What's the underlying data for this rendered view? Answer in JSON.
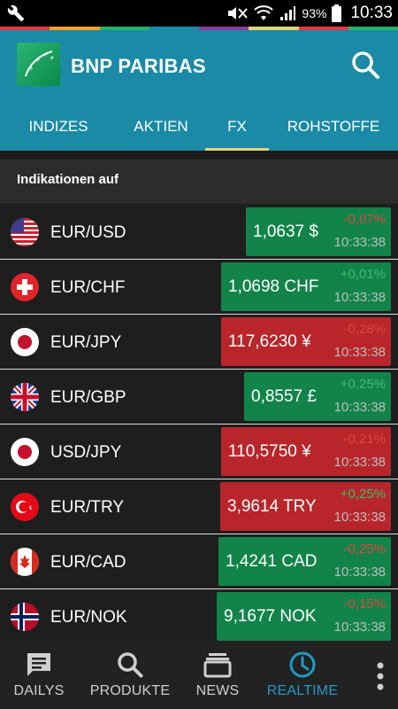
{
  "status_bar": {
    "battery_percent": "93%",
    "time": "10:33",
    "icons": [
      "wrench-icon",
      "mute-icon",
      "wifi-icon",
      "signal-icon",
      "battery-icon"
    ]
  },
  "accent_colors": [
    "#e2383f",
    "#f0a12b",
    "#26b36b",
    "#1a8aa6",
    "#8a3c9a",
    "#e2d37a"
  ],
  "app_bar": {
    "brand": "BNP PARIBAS",
    "logo_icon": "bnp-stars-logo",
    "search_icon": "search-icon",
    "background": "#1a8aa6"
  },
  "tabs": [
    {
      "label": "INDIZES",
      "active": false
    },
    {
      "label": "AKTIEN",
      "active": false
    },
    {
      "label": "FX",
      "active": true
    },
    {
      "label": "ROHSTOFFE",
      "active": false
    }
  ],
  "section": {
    "title": "Indikationen auf"
  },
  "rows": [
    {
      "pair": "EUR/USD",
      "flag": "us-flag-icon",
      "price": "1,0637 $",
      "change": "-0,07%",
      "time": "10:33:38",
      "box": "green",
      "trend": "neg"
    },
    {
      "pair": "EUR/CHF",
      "flag": "ch-flag-icon",
      "price": "1,0698 CHF",
      "change": "+0,01%",
      "time": "10:33:38",
      "box": "green",
      "trend": "pos"
    },
    {
      "pair": "EUR/JPY",
      "flag": "jp-flag-icon",
      "price": "117,6230 ¥",
      "change": "-0,28%",
      "time": "10:33:38",
      "box": "red",
      "trend": "neg"
    },
    {
      "pair": "EUR/GBP",
      "flag": "gb-flag-icon",
      "price": "0,8557 £",
      "change": "+0,25%",
      "time": "10:33:38",
      "box": "green",
      "trend": "pos"
    },
    {
      "pair": "USD/JPY",
      "flag": "jp-flag-icon",
      "price": "110,5750 ¥",
      "change": "-0,21%",
      "time": "10:33:38",
      "box": "red",
      "trend": "neg"
    },
    {
      "pair": "EUR/TRY",
      "flag": "tr-flag-icon",
      "price": "3,9614 TRY",
      "change": "+0,25%",
      "time": "10:33:38",
      "box": "red",
      "trend": "pos"
    },
    {
      "pair": "EUR/CAD",
      "flag": "ca-flag-icon",
      "price": "1,4241 CAD",
      "change": "-0,25%",
      "time": "10:33:38",
      "box": "green",
      "trend": "neg"
    },
    {
      "pair": "EUR/NOK",
      "flag": "no-flag-icon",
      "price": "9,1677 NOK",
      "change": "-0,15%",
      "time": "10:33:38",
      "box": "green",
      "trend": "neg"
    }
  ],
  "bottom_nav": [
    {
      "label": "DAILYS",
      "icon": "chat-icon",
      "active": false
    },
    {
      "label": "PRODUKTE",
      "icon": "search-icon",
      "active": false
    },
    {
      "label": "NEWS",
      "icon": "news-stack-icon",
      "active": false
    },
    {
      "label": "REALTIME",
      "icon": "clock-icon",
      "active": true
    }
  ],
  "overflow_icon": "more-vert-icon"
}
